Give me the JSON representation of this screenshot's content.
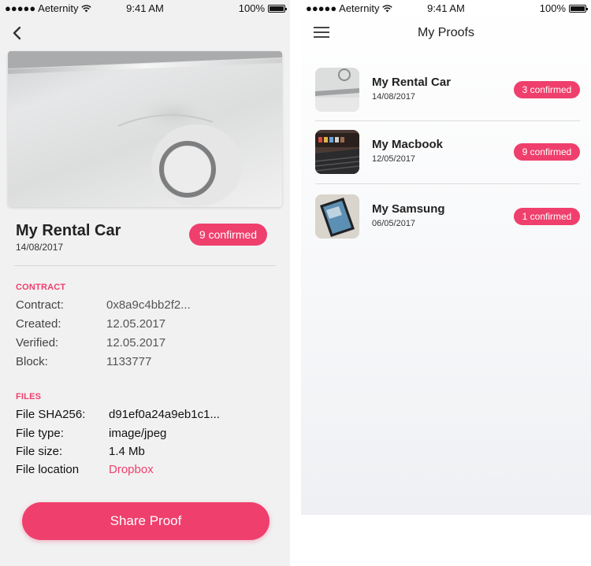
{
  "status_bar": {
    "carrier": "●●●●● Aeternity",
    "time": "9:41 AM",
    "battery": "100%"
  },
  "detail": {
    "title": "My Rental Car",
    "date": "14/08/2017",
    "badge": "9 confirmed",
    "contract_section": {
      "label": "CONTRACT",
      "rows": [
        {
          "key": "Contract:",
          "value": "0x8a9c4bb2f2..."
        },
        {
          "key": "Created:",
          "value": "12.05.2017"
        },
        {
          "key": "Verified:",
          "value": "12.05.2017"
        },
        {
          "key": "Block:",
          "value": "1133777"
        }
      ]
    },
    "files_section": {
      "label": "FILES",
      "rows": [
        {
          "key": "File SHA256:",
          "value": "d91ef0a24a9eb1c1..."
        },
        {
          "key": "File type:",
          "value": "image/jpeg"
        },
        {
          "key": "File size:",
          "value": "1.4 Mb"
        },
        {
          "key": "File location",
          "value": "Dropbox"
        }
      ]
    },
    "share_button": "Share Proof"
  },
  "list": {
    "title": "My Proofs",
    "items": [
      {
        "title": "My Rental Car",
        "date": "14/08/2017",
        "badge": "3 confirmed"
      },
      {
        "title": "My Macbook",
        "date": "12/05/2017",
        "badge": "9 confirmed"
      },
      {
        "title": "My Samsung",
        "date": "06/05/2017",
        "badge": "1 confirmed"
      }
    ]
  },
  "colors": {
    "accent": "#ef3f6c",
    "left_background": "#f1f1f2"
  },
  "icons": [
    "back-chevron-icon",
    "menu-icon",
    "wifi-icon",
    "battery-icon"
  ]
}
